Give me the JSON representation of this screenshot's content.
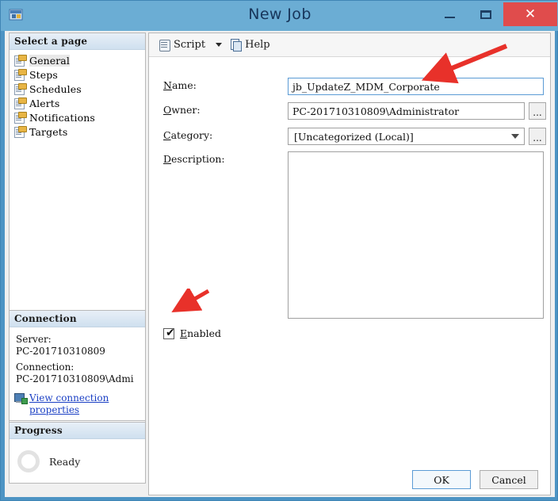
{
  "window": {
    "title": "New Job",
    "icon": "job-icon",
    "buttons": {
      "minimize": "minimize",
      "maximize": "maximize",
      "close": "close"
    }
  },
  "sidebar": {
    "header": "Select a page",
    "items": [
      {
        "label": "General",
        "icon": "page-icon",
        "selected": true
      },
      {
        "label": "Steps",
        "icon": "page-icon",
        "selected": false
      },
      {
        "label": "Schedules",
        "icon": "page-icon",
        "selected": false
      },
      {
        "label": "Alerts",
        "icon": "page-icon",
        "selected": false
      },
      {
        "label": "Notifications",
        "icon": "page-icon",
        "selected": false
      },
      {
        "label": "Targets",
        "icon": "page-icon",
        "selected": false
      }
    ]
  },
  "connection": {
    "header": "Connection",
    "server_label": "Server:",
    "server_value": "PC-201710310809",
    "connection_label": "Connection:",
    "connection_value": "PC-201710310809\\Admi",
    "link_line1": "View connection",
    "link_line2": "properties",
    "link_icon": "server-connection-icon"
  },
  "progress": {
    "header": "Progress",
    "status": "Ready",
    "icon": "spinner-icon"
  },
  "toolbar": {
    "script_label": "Script",
    "script_icon": "script-scroll-icon",
    "script_caret": "chevron-down-icon",
    "help_label": "Help",
    "help_icon": "help-pages-icon"
  },
  "form": {
    "name": {
      "label_mnemonic": "N",
      "label_rest": "ame:",
      "value": "jb_UpdateZ_MDM_Corporate",
      "focused": true
    },
    "owner": {
      "label_mnemonic": "O",
      "label_rest": "wner:",
      "value": "PC-201710310809\\Administrator",
      "browse_label": "..."
    },
    "category": {
      "label_mnemonic": "C",
      "label_rest": "ategory:",
      "value": "[Uncategorized (Local)]",
      "browse_label": "...",
      "options": [
        "[Uncategorized (Local)]"
      ]
    },
    "description": {
      "label_mnemonic": "D",
      "label_rest": "escription:",
      "value": ""
    },
    "enabled": {
      "label_mnemonic": "E",
      "label_rest": "nabled",
      "checked": true,
      "check_glyph": "✔"
    }
  },
  "footer": {
    "ok_label": "OK",
    "cancel_label": "Cancel"
  },
  "annotations": {
    "arrow_color": "#e8312a",
    "arrow_name_field": "arrow-pointing-to-name-field",
    "arrow_enabled_checkbox": "arrow-pointing-to-enabled-checkbox"
  }
}
